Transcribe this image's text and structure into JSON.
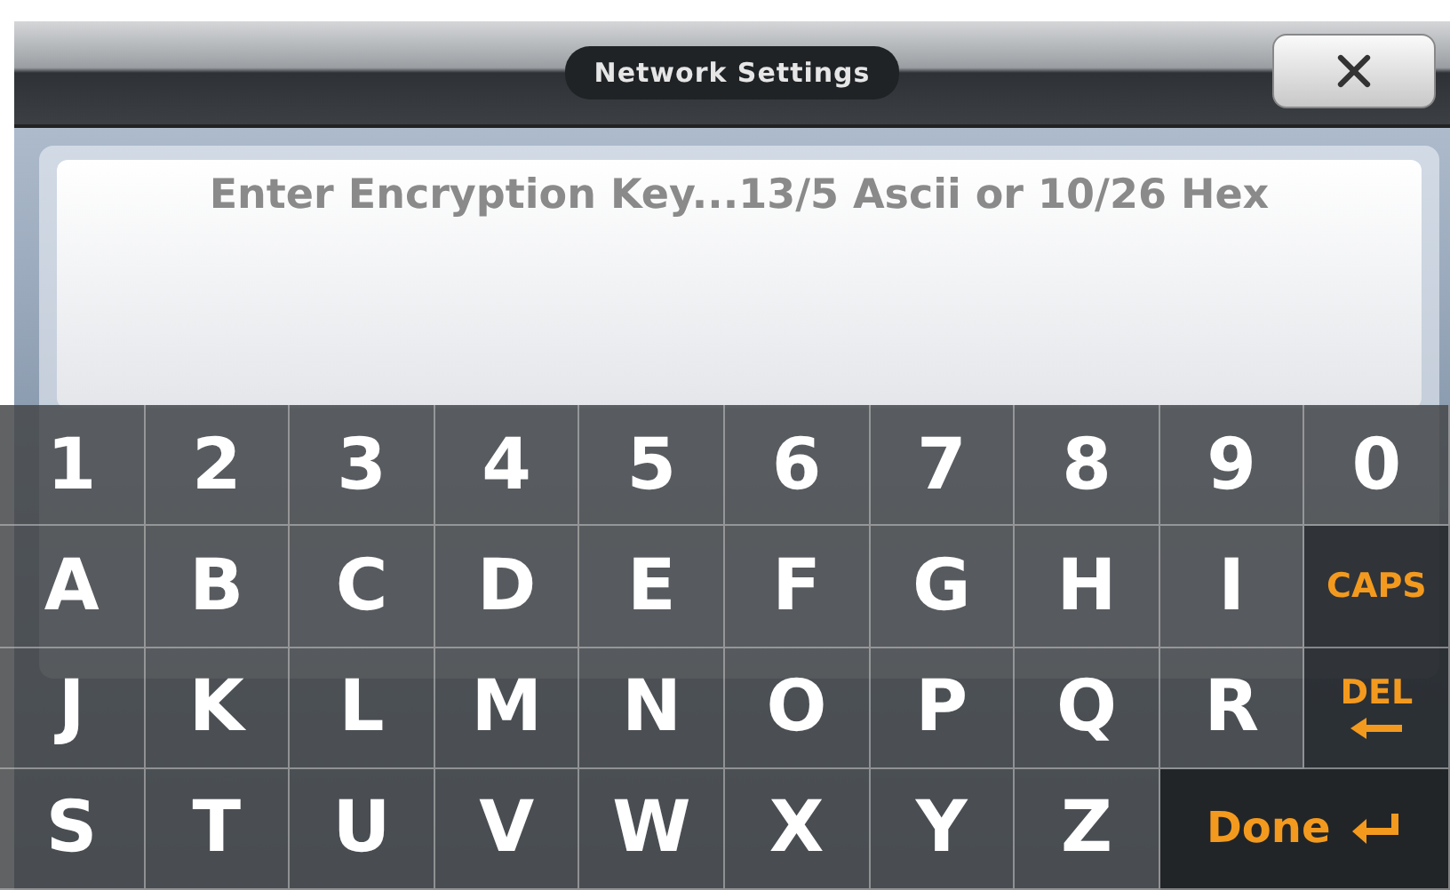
{
  "window": {
    "title": "Network Settings"
  },
  "field": {
    "placeholder": "Enter Encryption Key...13/5 Ascii or 10/26 Hex"
  },
  "keyboard": {
    "rows": [
      [
        {
          "label": "1",
          "kind": "char"
        },
        {
          "label": "2",
          "kind": "char"
        },
        {
          "label": "3",
          "kind": "char"
        },
        {
          "label": "4",
          "kind": "char"
        },
        {
          "label": "5",
          "kind": "char"
        },
        {
          "label": "6",
          "kind": "char"
        },
        {
          "label": "7",
          "kind": "char"
        },
        {
          "label": "8",
          "kind": "char"
        },
        {
          "label": "9",
          "kind": "char"
        },
        {
          "label": "0",
          "kind": "char"
        }
      ],
      [
        {
          "label": "A",
          "kind": "char"
        },
        {
          "label": "B",
          "kind": "char"
        },
        {
          "label": "C",
          "kind": "char"
        },
        {
          "label": "D",
          "kind": "char"
        },
        {
          "label": "E",
          "kind": "char"
        },
        {
          "label": "F",
          "kind": "char"
        },
        {
          "label": "G",
          "kind": "char"
        },
        {
          "label": "H",
          "kind": "char"
        },
        {
          "label": "I",
          "kind": "char"
        },
        {
          "label": "CAPS",
          "kind": "caps"
        }
      ],
      [
        {
          "label": "J",
          "kind": "char"
        },
        {
          "label": "K",
          "kind": "char"
        },
        {
          "label": "L",
          "kind": "char"
        },
        {
          "label": "M",
          "kind": "char"
        },
        {
          "label": "N",
          "kind": "char"
        },
        {
          "label": "O",
          "kind": "char"
        },
        {
          "label": "P",
          "kind": "char"
        },
        {
          "label": "Q",
          "kind": "char"
        },
        {
          "label": "R",
          "kind": "char"
        },
        {
          "label": "DEL",
          "kind": "del"
        }
      ],
      [
        {
          "label": "S",
          "kind": "char"
        },
        {
          "label": "T",
          "kind": "char"
        },
        {
          "label": "U",
          "kind": "char"
        },
        {
          "label": "V",
          "kind": "char"
        },
        {
          "label": "W",
          "kind": "char"
        },
        {
          "label": "X",
          "kind": "char"
        },
        {
          "label": "Y",
          "kind": "char"
        },
        {
          "label": "Z",
          "kind": "char"
        },
        {
          "label": "Done",
          "kind": "done"
        }
      ]
    ]
  }
}
